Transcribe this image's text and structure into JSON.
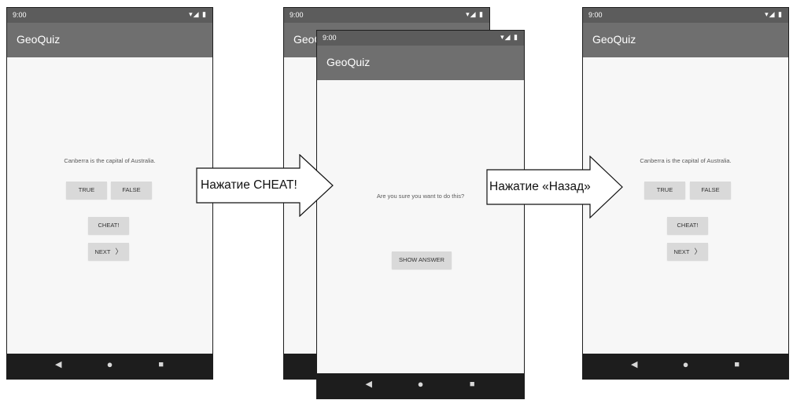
{
  "screens": [
    {
      "status_time": "9:00",
      "status_icons": "▾◢ ▮",
      "app_title": "GeoQuiz",
      "question": "Canberra is the capital of Australia.",
      "true_label": "TRUE",
      "false_label": "FALSE",
      "cheat_label": "CHEAT!",
      "next_label": "NEXT",
      "next_chevron": "〉",
      "nav_back": "◀",
      "nav_home": "●",
      "nav_recent": "■"
    },
    {
      "status_time": "9:00",
      "status_icons": "▾◢ ▮",
      "app_title": "GeoQuiz",
      "nav_back": "◀",
      "nav_home": "●",
      "nav_recent": "■"
    },
    {
      "status_time": "9:00",
      "status_icons": "▾◢ ▮",
      "app_title": "GeoQuiz",
      "prompt": "Are you sure you want to do this?",
      "show_answer_label": "SHOW ANSWER",
      "nav_back": "◀",
      "nav_home": "●",
      "nav_recent": "■"
    },
    {
      "status_time": "9:00",
      "status_icons": "▾◢ ▮",
      "app_title": "GeoQuiz",
      "question": "Canberra is the capital of Australia.",
      "true_label": "TRUE",
      "false_label": "FALSE",
      "cheat_label": "CHEAT!",
      "next_label": "NEXT",
      "next_chevron": "〉",
      "nav_back": "◀",
      "nav_home": "●",
      "nav_recent": "■"
    }
  ],
  "arrows": [
    {
      "label": "Нажатие CHEAT!"
    },
    {
      "label": "Нажатие «Назад»"
    }
  ]
}
